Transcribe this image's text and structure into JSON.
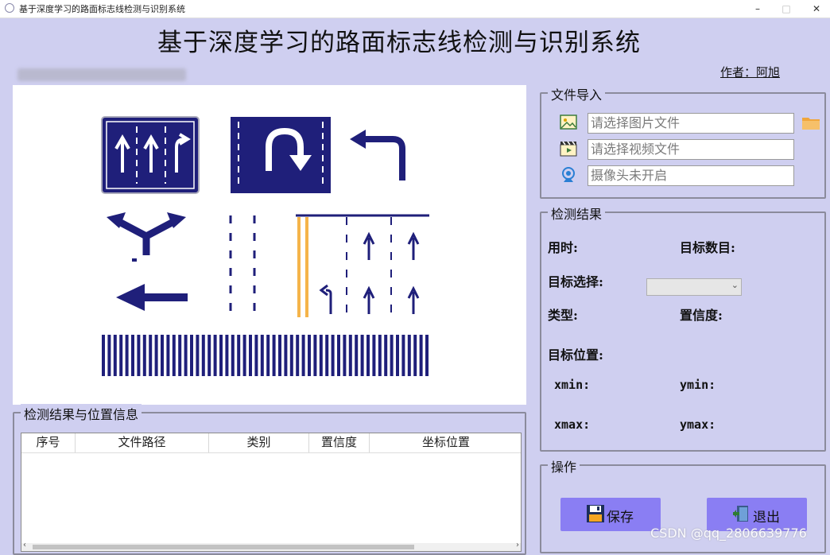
{
  "window": {
    "title": "基于深度学习的路面标志线检测与识别系统",
    "min_glyph": "–",
    "max_glyph": "□",
    "close_glyph": "✕"
  },
  "header": {
    "title": "基于深度学习的路面标志线检测与识别系统",
    "author": "作者：阿旭"
  },
  "file_import": {
    "group_title": "文件导入",
    "image_placeholder": "请选择图片文件",
    "video_placeholder": "请选择视频文件",
    "camera_status": "摄像头未开启",
    "icons": [
      "image-icon",
      "video-icon",
      "camera-icon",
      "folder-icon"
    ]
  },
  "detect_result": {
    "group_title": "检测结果",
    "time_label": "用时:",
    "count_label": "目标数目:",
    "select_label": "目标选择:",
    "select_value": "",
    "type_label": "类型:",
    "conf_label": "置信度:",
    "pos_label": "目标位置:",
    "xmin_label": "xmin:",
    "ymin_label": "ymin:",
    "xmax_label": "xmax:",
    "ymax_label": "ymax:"
  },
  "operations": {
    "group_title": "操作",
    "save_label": "保存",
    "exit_label": "退出"
  },
  "results_table": {
    "group_title": "检测结果与位置信息",
    "columns": [
      "序号",
      "文件路径",
      "类别",
      "置信度",
      "坐标位置"
    ],
    "rows": []
  },
  "watermark": "CSDN @qq_2806639776",
  "colors": {
    "background": "#cfcff0",
    "button": "#8a7ef3",
    "sign_blue": "#1f1f7a",
    "lane_orange": "#f5b44a"
  }
}
